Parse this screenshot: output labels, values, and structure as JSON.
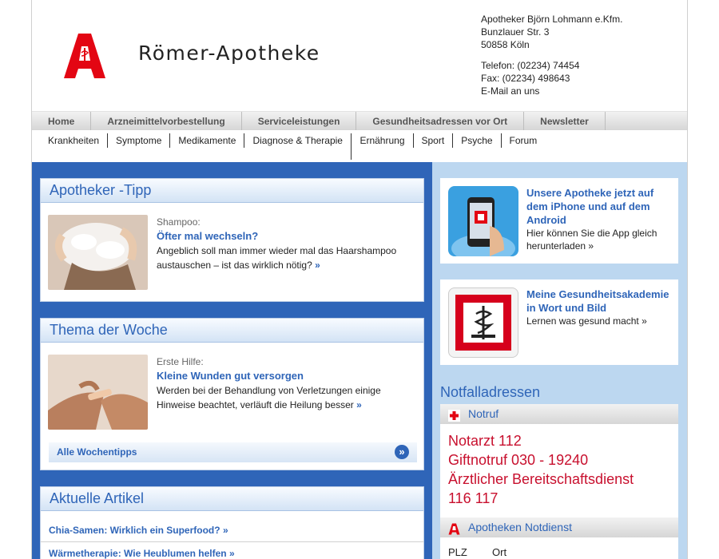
{
  "header": {
    "brand": "Römer-Apotheke",
    "contact": {
      "owner": "Apotheker Björn Lohmann e.Kfm.",
      "street": "Bunzlauer Str. 3",
      "city": "50858 Köln",
      "phone": "Telefon: (02234) 74454",
      "fax": "Fax: (02234) 498643",
      "email": "E-Mail an uns"
    },
    "logo_color": "#e30613"
  },
  "main_nav": [
    {
      "label": "Home"
    },
    {
      "label": "Arzneimittelvorbestellung"
    },
    {
      "label": "Serviceleistungen"
    },
    {
      "label": "Gesundheitsadressen vor Ort"
    },
    {
      "label": "Newsletter"
    }
  ],
  "sub_nav": [
    {
      "label": "Krankheiten"
    },
    {
      "label": "Symptome"
    },
    {
      "label": "Medikamente"
    },
    {
      "label": "Diagnose & Therapie"
    },
    {
      "label": "Ernährung"
    },
    {
      "label": "Sport"
    },
    {
      "label": "Psyche"
    },
    {
      "label": "Forum"
    }
  ],
  "tipp": {
    "title": "Apotheker -Tipp",
    "kicker": "Shampoo:",
    "headline": "Öfter mal wechseln?",
    "text": "Angeblich soll man immer wieder mal das Haarshampoo austauschen – ist das wirklich nötig?",
    "more": "»"
  },
  "woche": {
    "title": "Thema der Woche",
    "kicker": "Erste Hilfe:",
    "headline": "Kleine Wunden gut versorgen",
    "text": "Werden bei der Behandlung von Verletzungen einige Hinweise beachtet, verläuft die Heilung besser",
    "more": "»",
    "all_label": "Alle Wochentipps",
    "all_icon": "»"
  },
  "artikel": {
    "title": "Aktuelle Artikel",
    "items": [
      {
        "label": "Chia-Samen: Wirklich ein Superfood?",
        "more": "»"
      },
      {
        "label": "Wärmetherapie: Wie Heublumen helfen",
        "more": "»"
      }
    ]
  },
  "promos": [
    {
      "title": "Unsere Apotheke jetzt auf dem iPhone und auf dem Android",
      "text": "Hier können Sie die App gleich herunterladen »",
      "icon": "phone-app-icon"
    },
    {
      "title": "Meine Gesundheitsakademie in Wort und Bild",
      "text": "Lernen was gesund macht »",
      "icon": "aesculap-icon"
    }
  ],
  "notfall": {
    "title": "Notfalladressen",
    "notruf": {
      "label": "Notruf",
      "lines": [
        "Notarzt 112",
        "Giftnotruf 030 - 19240",
        "Ärztlicher Bereitschaftsdienst",
        "116 117"
      ]
    },
    "notdienst": {
      "label": "Apotheken Notdienst",
      "plz_label": "PLZ",
      "ort_label": "Ort"
    }
  },
  "colors": {
    "accent_blue": "#2f65b8",
    "emergency_red": "#c8102e",
    "right_bg": "#bcd7f0"
  }
}
